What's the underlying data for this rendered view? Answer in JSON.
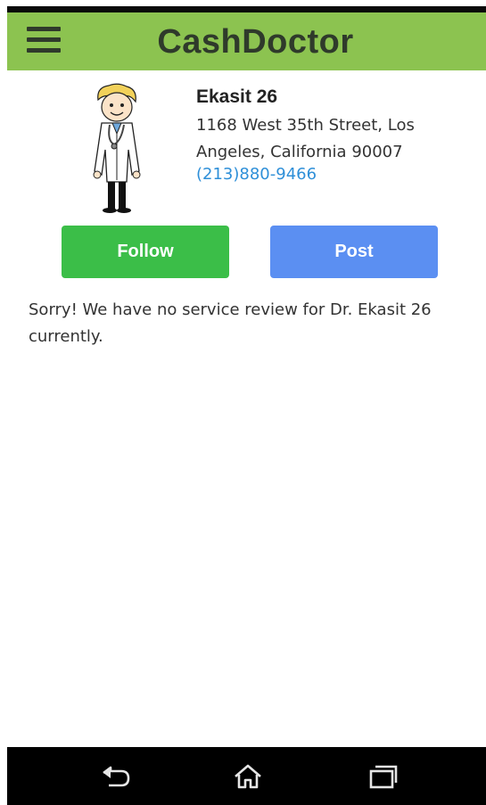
{
  "app": {
    "title": "CashDoctor"
  },
  "doctor": {
    "name": "Ekasit 26",
    "address": "1168 West 35th Street, Los Angeles, California 90007",
    "phone": "(213)880-9466"
  },
  "actions": {
    "follow_label": "Follow",
    "post_label": "Post"
  },
  "reviews": {
    "empty_message": "Sorry! We have no service review for Dr. Ekasit 26 currently."
  },
  "icons": {
    "menu": "hamburger-menu-icon",
    "back": "back-icon",
    "home": "home-icon",
    "recents": "recent-apps-icon"
  },
  "colors": {
    "header_bg": "#8cc350",
    "follow_bg": "#3bbe48",
    "post_bg": "#5b8ff2",
    "link": "#2e8fd8"
  }
}
